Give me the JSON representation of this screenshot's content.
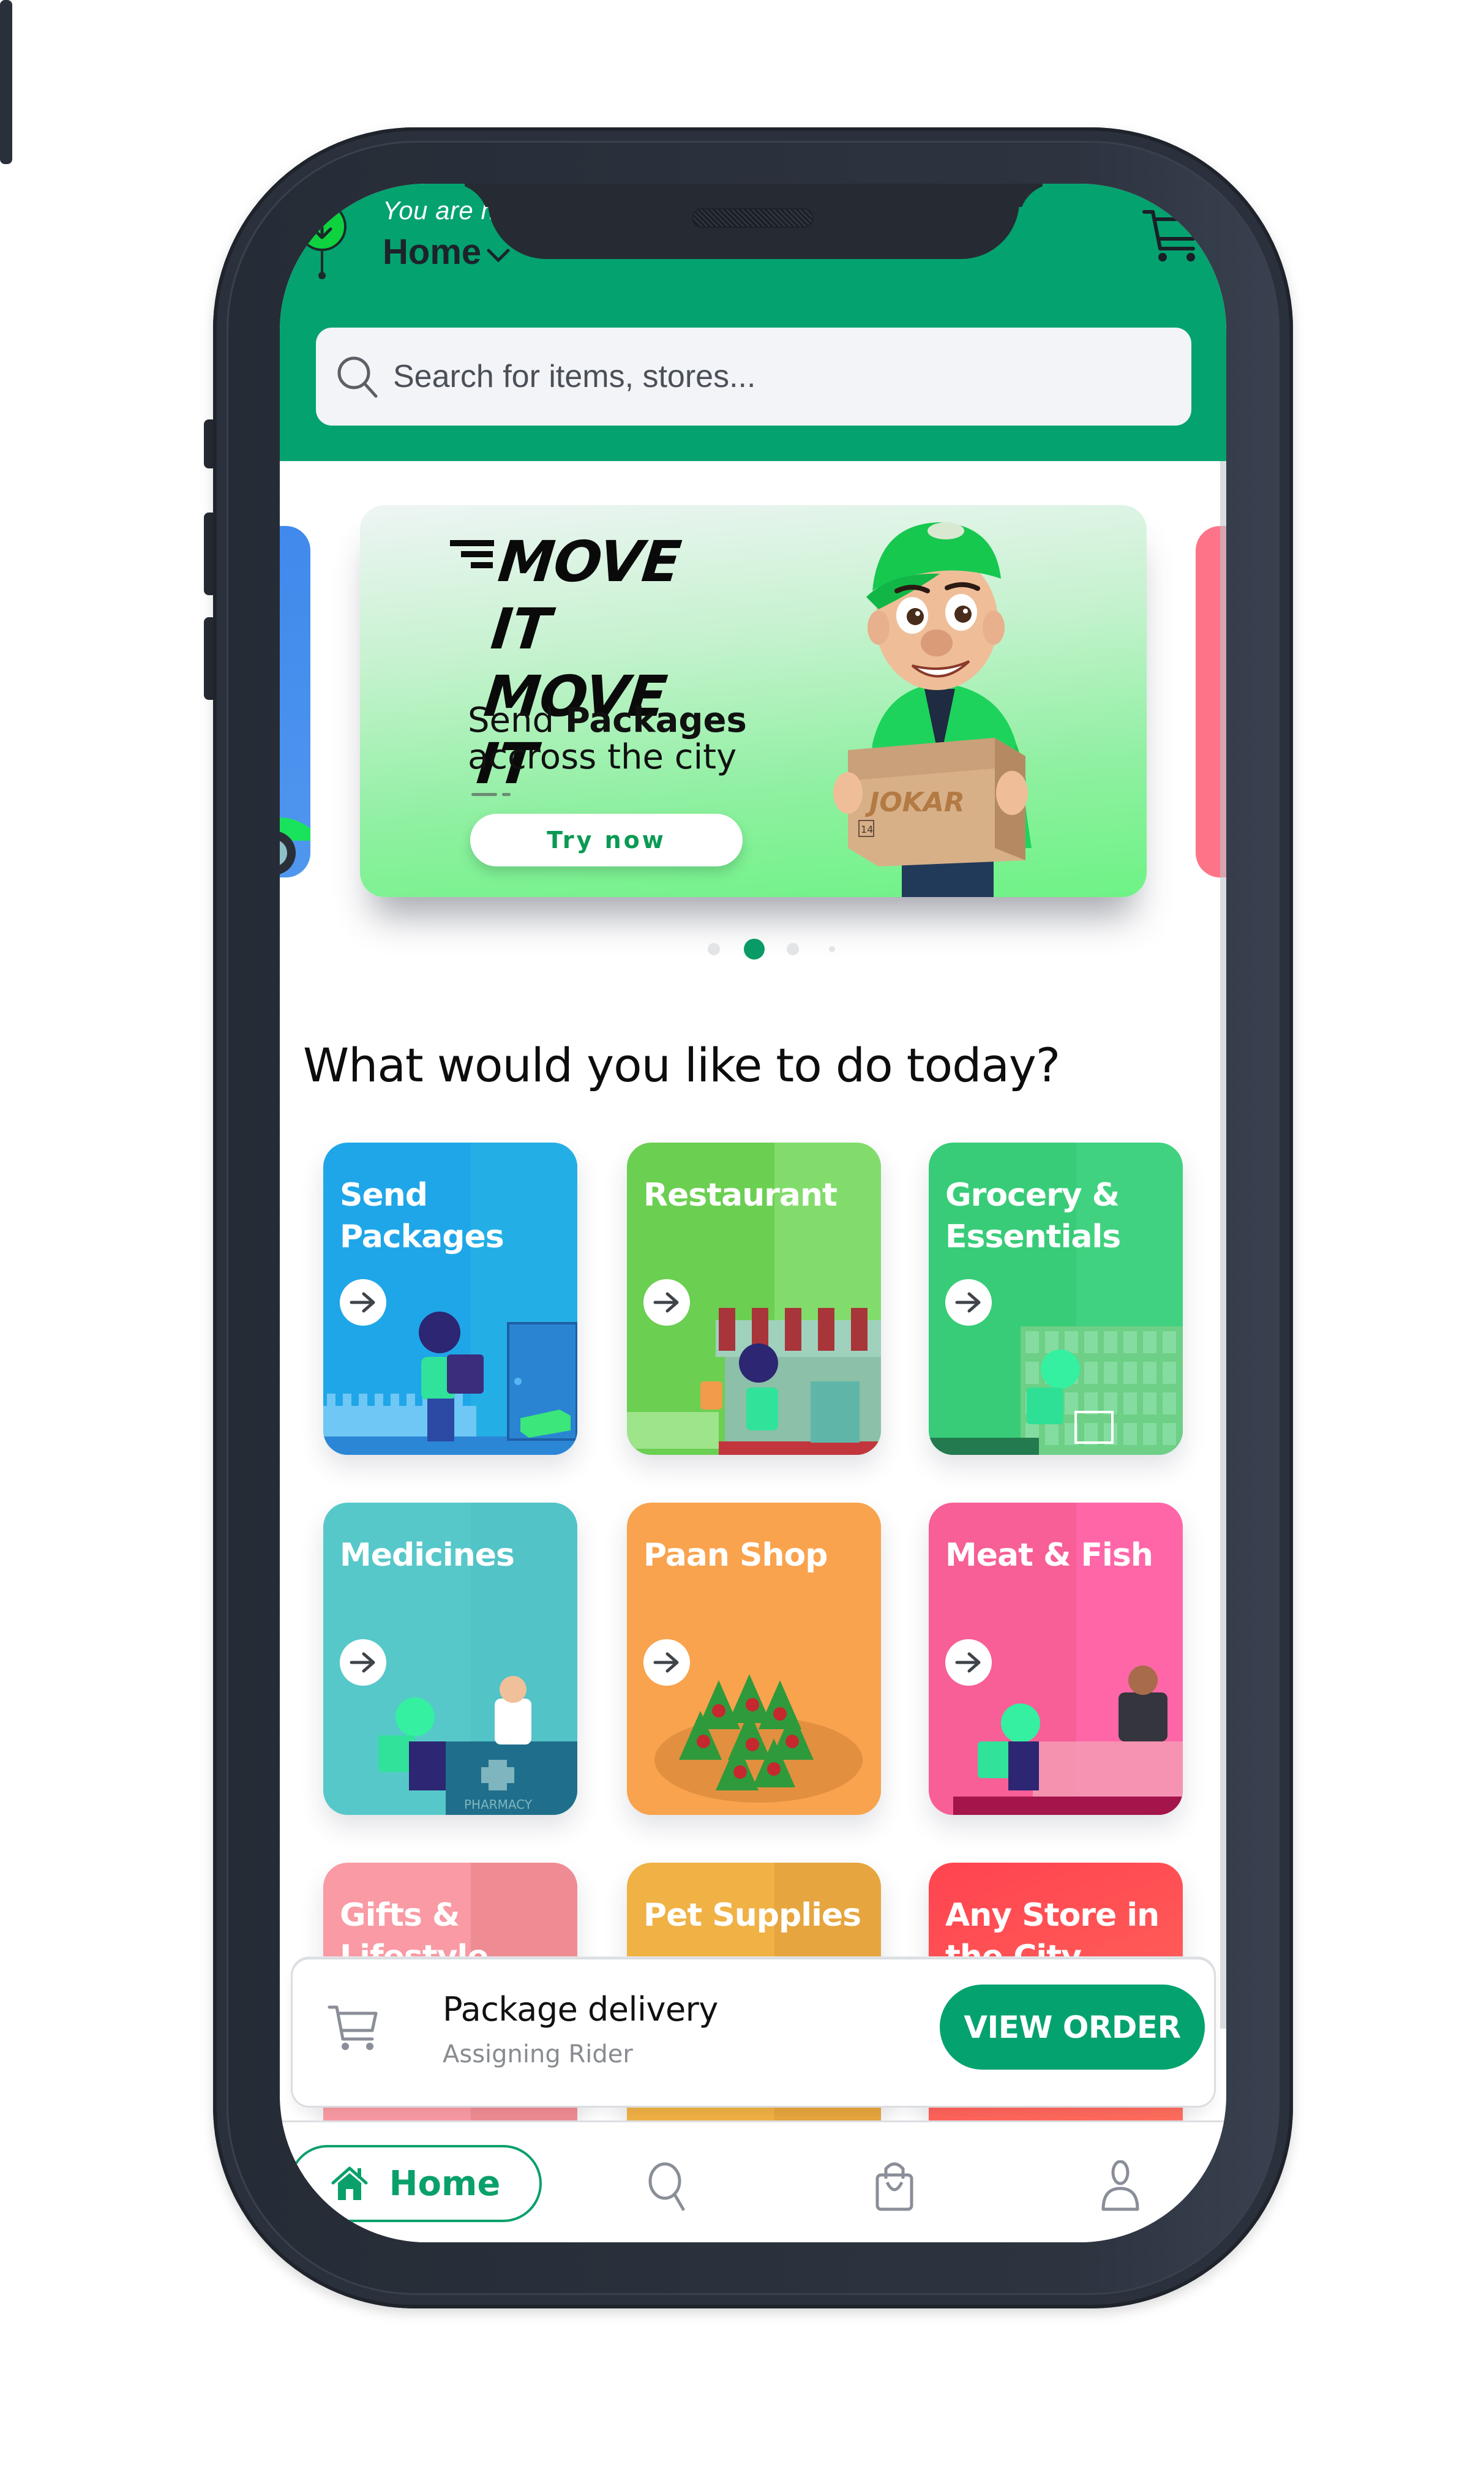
{
  "header": {
    "location_hint": "You are here",
    "location_name": "Home",
    "icons": {
      "location": "location-pin-icon",
      "dropdown": "chevron-down-icon",
      "cart": "cart-icon"
    },
    "bg_color": "#04a26f"
  },
  "search": {
    "placeholder": "Search for items, stores...",
    "value": "",
    "icon": "search-icon"
  },
  "carousel": {
    "slide_count": 4,
    "active_index": 1,
    "active_banner": {
      "title_line1": "MOVE IT",
      "title_line2": "MOVE IT",
      "subtitle_prefix": "Send ",
      "subtitle_bold": "Packages",
      "subtitle_line2": "accross the city",
      "cta_label": "Try now",
      "box_brand": "JOKAR",
      "box_label": "14"
    }
  },
  "section": {
    "title": "What would you like to do today?"
  },
  "categories": [
    {
      "label": "Send Packages",
      "color": "#1fa6e8",
      "color_alt": "#24aee6"
    },
    {
      "label": "Restaurant",
      "color": "#6bcf52",
      "color_alt": "#82dc6c"
    },
    {
      "label": "Grocery & Essentials",
      "color": "#38cc78",
      "color_alt": "#40d280"
    },
    {
      "label": "Medicines",
      "color": "#57c8c9",
      "color_alt": "#52c3c7",
      "art_text": "PHARMACY"
    },
    {
      "label": "Paan Shop",
      "color": "#f9a34e",
      "color_alt": "#f9a34e"
    },
    {
      "label": "Meat & Fish",
      "color": "#f75f96",
      "color_alt": "#ff66a8"
    },
    {
      "label": "Gifts & Lifestyle",
      "color": "#f99aa4",
      "color_alt": "#ef8c93"
    },
    {
      "label": "Pet Supplies",
      "color": "#f0b145",
      "color_alt": "#e6a53e"
    },
    {
      "label": "Any Store in the City",
      "color": "#ff4350",
      "color_alt": "#ff7560"
    }
  ],
  "active_order": {
    "title": "Package delivery",
    "status": "Assigning Rider",
    "action_label": "VIEW ORDER",
    "icon": "cart-icon"
  },
  "bottom_nav": {
    "items": [
      {
        "label": "Home",
        "icon": "home-icon",
        "active": true
      },
      {
        "label": "",
        "icon": "search-icon",
        "active": false
      },
      {
        "label": "",
        "icon": "shopping-bag-icon",
        "active": false
      },
      {
        "label": "",
        "icon": "profile-icon",
        "active": false
      }
    ],
    "accent": "#0aa06a"
  }
}
